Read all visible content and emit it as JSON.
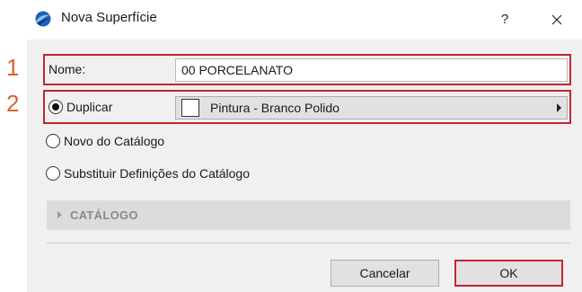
{
  "window": {
    "title": "Nova Superfície",
    "help_label": "?",
    "app_icon": "archicad-logo-icon",
    "close_icon": "close-icon"
  },
  "callouts": [
    "1",
    "2"
  ],
  "name_row": {
    "label": "Nome:",
    "value": "00 PORCELANATO"
  },
  "options": {
    "duplicate": {
      "label": "Duplicar",
      "checked": true
    },
    "surface": {
      "label": "Pintura - Branco Polido",
      "swatch_color": "#ffffff"
    },
    "new_from_catalog": {
      "label": "Novo do Catálogo",
      "checked": false
    },
    "replace_from_catalog": {
      "label": "Substituir Definições do Catálogo",
      "checked": false
    }
  },
  "catalog": {
    "label": "CATÁLOGO",
    "expanded": false
  },
  "buttons": {
    "cancel": "Cancelar",
    "ok": "OK"
  },
  "colors": {
    "highlight": "#c0262f",
    "callout": "#d9642c"
  }
}
